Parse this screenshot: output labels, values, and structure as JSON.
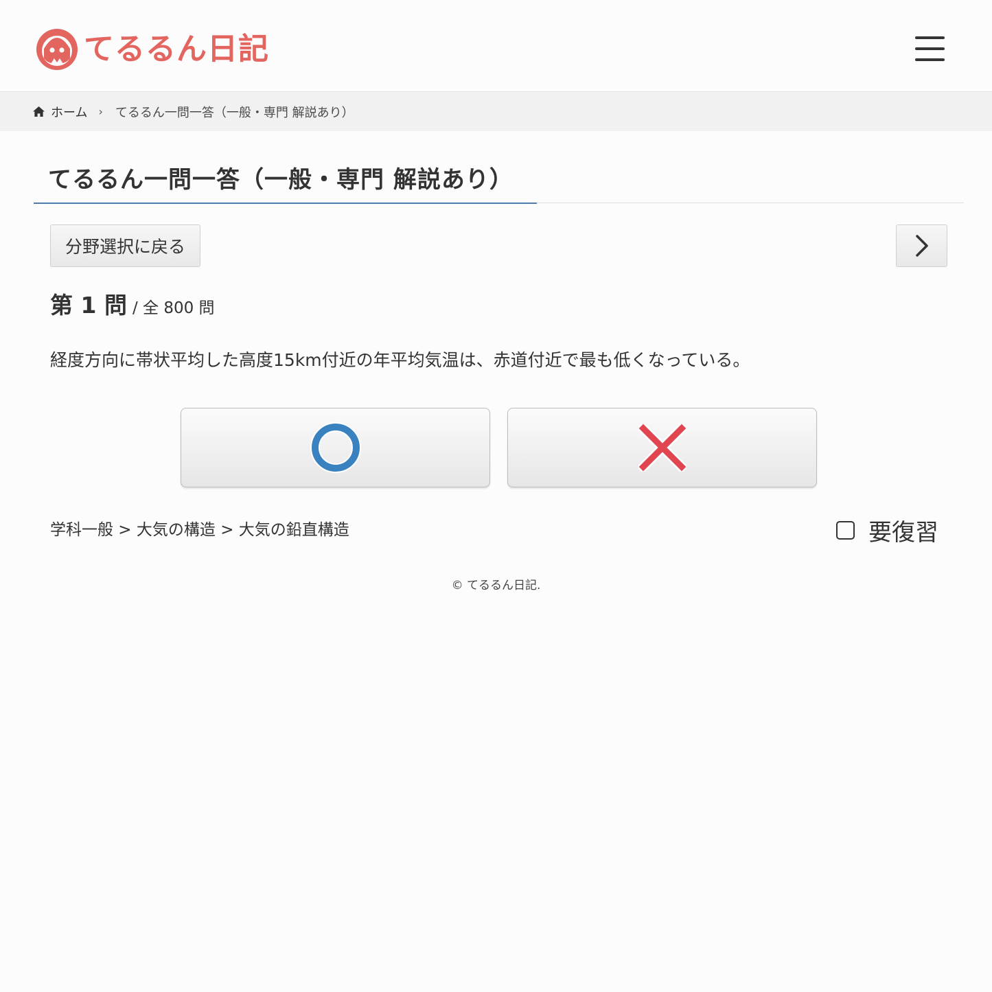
{
  "site": {
    "logo_text": "てるるん日記",
    "brand_color": "#e36560"
  },
  "icons": {
    "logo": "mascot-icon",
    "menu": "hamburger-menu-icon",
    "home": "home-icon",
    "breadcrumb_separator": "chevron-right-icon",
    "next": "chevron-right-icon",
    "answer_true": "circle-icon",
    "answer_false": "cross-icon"
  },
  "breadcrumb": {
    "home_label": "ホーム",
    "separator": "›",
    "current_label": "てるるん一問一答（一般・専門 解説あり）"
  },
  "page": {
    "title": "てるるん一問一答（一般・専門 解説あり）",
    "accent_color": "#4a7cb0"
  },
  "navigation": {
    "back_label": "分野選択に戻る"
  },
  "question": {
    "number_label": "第 1 問",
    "total_label": "/ 全 800 問",
    "text": "経度方向に帯状平均した高度15km付近の年平均気温は、赤道付近で最も低くなっている。",
    "category_path": "学科一般 > 大気の構造 > 大気の鉛直構造"
  },
  "answers": {
    "true_color": "#3a82bf",
    "false_color": "#e04550"
  },
  "review": {
    "label": "要復習",
    "checked": false
  },
  "footer": {
    "copyright": "© てるるん日記."
  }
}
